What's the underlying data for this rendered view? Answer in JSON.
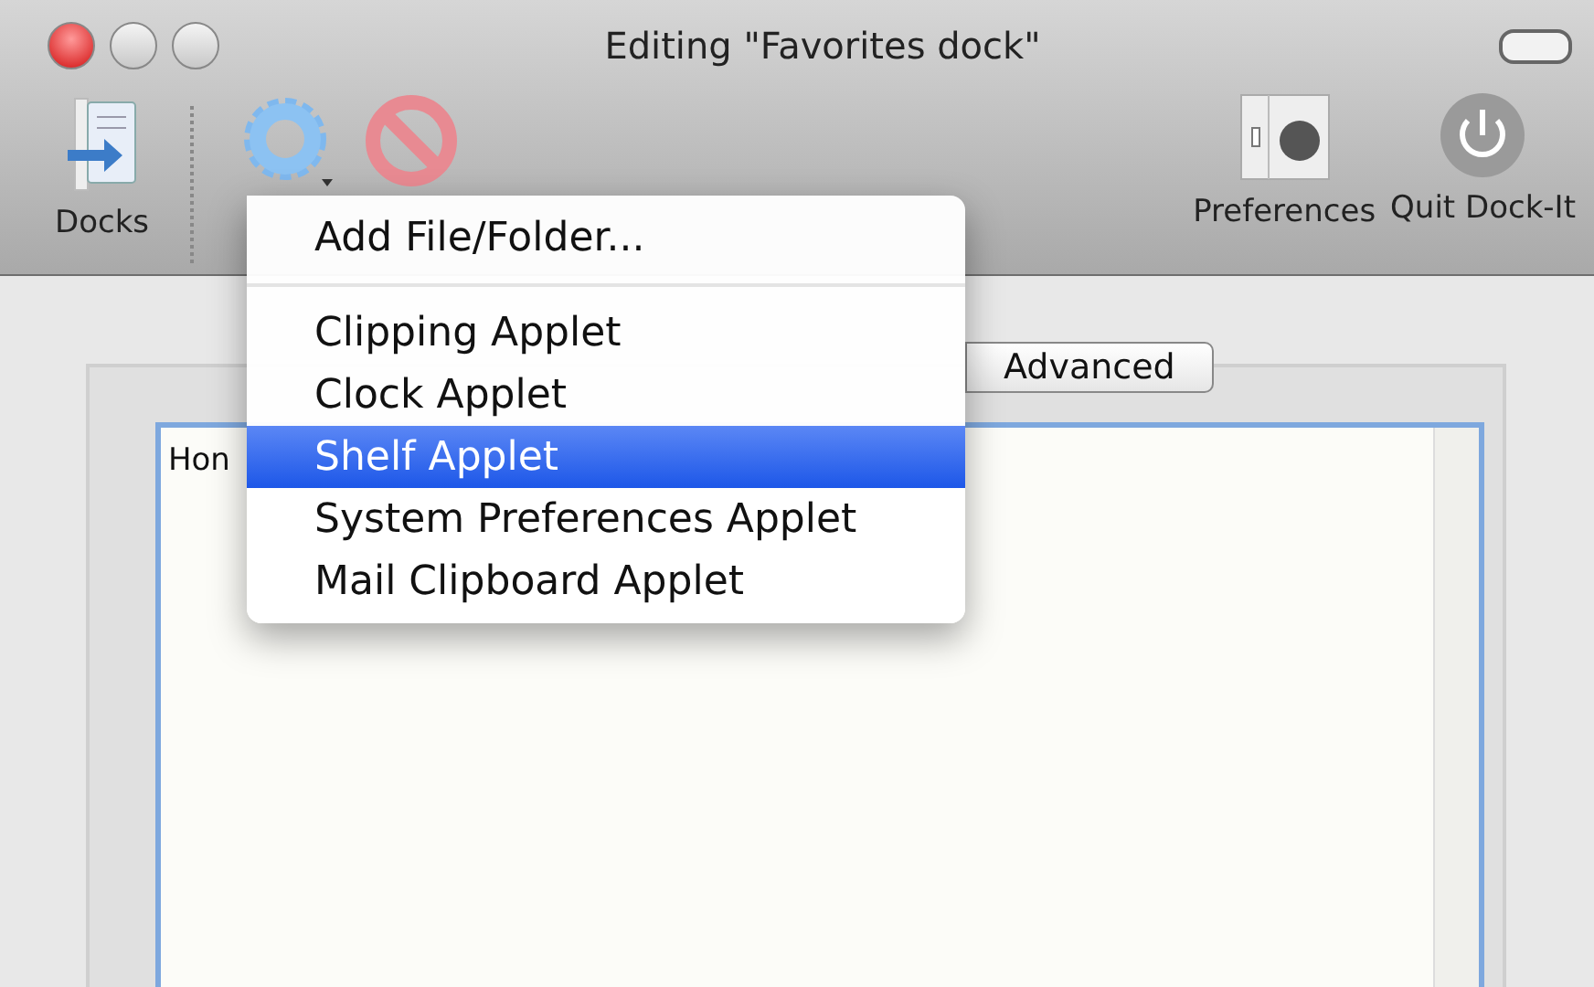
{
  "window": {
    "title": "Editing \"Favorites dock\""
  },
  "toolbar": {
    "items": [
      {
        "kind": "docks",
        "label": "Docks"
      },
      {
        "kind": "gear"
      },
      {
        "kind": "remove"
      },
      {
        "kind": "preferences",
        "label": "Preferences"
      },
      {
        "kind": "quit",
        "label": "Quit Dock-It"
      }
    ]
  },
  "tabs": [
    {
      "label": "Advanced",
      "selected": false
    }
  ],
  "list": {
    "items": [
      "Hon"
    ]
  },
  "menu": {
    "sections": [
      {
        "items": [
          {
            "label": "Add File/Folder...",
            "selected": false
          }
        ]
      },
      {
        "items": [
          {
            "label": "Clipping Applet",
            "selected": false
          },
          {
            "label": "Clock Applet",
            "selected": false
          },
          {
            "label": "Shelf Applet",
            "selected": true
          },
          {
            "label": "System Preferences Applet",
            "selected": false
          },
          {
            "label": "Mail Clipboard Applet",
            "selected": false
          }
        ]
      }
    ]
  }
}
